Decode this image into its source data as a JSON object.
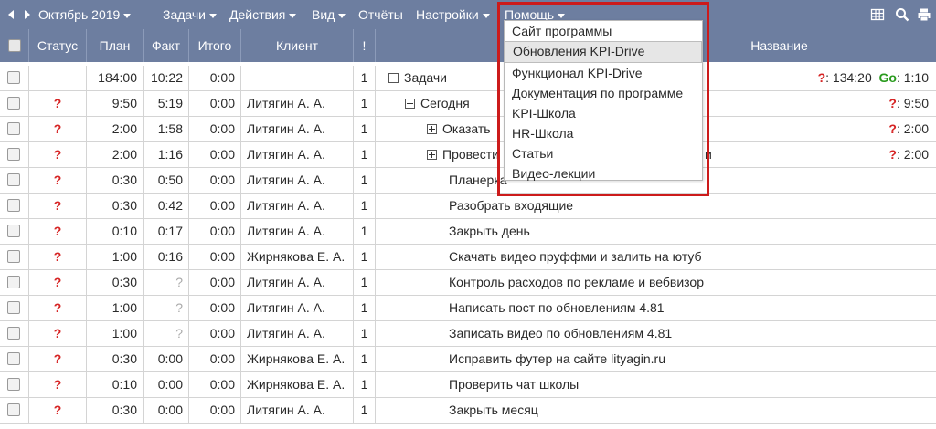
{
  "toolbar": {
    "period": "Октябрь 2019",
    "menus": [
      "Задачи",
      "Действия",
      "Вид",
      "Отчёты",
      "Настройки",
      "Помощь"
    ]
  },
  "columns": {
    "status": "Статус",
    "plan": "План",
    "fact": "Факт",
    "total": "Итого",
    "client": "Клиент",
    "excl": "!",
    "name": "Название"
  },
  "help_menu": {
    "items": [
      "Сайт программы",
      "Обновления KPI-Drive",
      "Функционал KPI-Drive",
      "Документация по программе",
      "KPI-Школа",
      "HR-Школа",
      "Статьи",
      "Видео-лекции"
    ],
    "hovered_index": 1
  },
  "rows": [
    {
      "status": "",
      "plan": "184:00",
      "fact": "10:22",
      "total": "0:00",
      "client": "",
      "excl": "1",
      "name": "Задачи",
      "tree": "minus",
      "indent": 0,
      "right_q": "?",
      "right_val": ": 134:20",
      "right_go": "Go",
      "right_go_val": ": 1:10"
    },
    {
      "status": "?",
      "plan": "9:50",
      "fact": "5:19",
      "total": "0:00",
      "client": "Литягин А. А.",
      "excl": "1",
      "name": "Сегодня",
      "tree": "minus",
      "indent": 1,
      "right_q": "?",
      "right_val": ": 9:50"
    },
    {
      "status": "?",
      "plan": "2:00",
      "fact": "1:58",
      "total": "0:00",
      "client": "Литягин А. А.",
      "excl": "1",
      "name": "Оказать",
      "tree": "plus",
      "indent": 2,
      "right_q": "?",
      "right_val": ": 2:00"
    },
    {
      "status": "?",
      "plan": "2:00",
      "fact": "1:16",
      "total": "0:00",
      "client": "Литягин А. А.",
      "excl": "1",
      "name": "Провести",
      "name_tail": "и",
      "tree": "plus",
      "indent": 2,
      "right_q": "?",
      "right_val": ": 2:00"
    },
    {
      "status": "?",
      "plan": "0:30",
      "fact": "0:50",
      "total": "0:00",
      "client": "Литягин А. А.",
      "excl": "1",
      "name": "Планерка",
      "indent": 3
    },
    {
      "status": "?",
      "plan": "0:30",
      "fact": "0:42",
      "total": "0:00",
      "client": "Литягин А. А.",
      "excl": "1",
      "name": "Разобрать входящие",
      "indent": 3
    },
    {
      "status": "?",
      "plan": "0:10",
      "fact": "0:17",
      "total": "0:00",
      "client": "Литягин А. А.",
      "excl": "1",
      "name": "Закрыть день",
      "indent": 3
    },
    {
      "status": "?",
      "plan": "1:00",
      "fact": "0:16",
      "total": "0:00",
      "client": "Жирнякова Е. А.",
      "excl": "1",
      "name": "Скачать видео пруффми и залить на ютуб",
      "indent": 3
    },
    {
      "status": "?",
      "plan": "0:30",
      "fact": "?",
      "total": "0:00",
      "client": "Литягин А. А.",
      "excl": "1",
      "name": "Контроль расходов по рекламе и вебвизор",
      "indent": 3
    },
    {
      "status": "?",
      "plan": "1:00",
      "fact": "?",
      "total": "0:00",
      "client": "Литягин А. А.",
      "excl": "1",
      "name": "Написать пост по обновлениям 4.81",
      "indent": 3
    },
    {
      "status": "?",
      "plan": "1:00",
      "fact": "?",
      "total": "0:00",
      "client": "Литягин А. А.",
      "excl": "1",
      "name": "Записать видео по обновлениям 4.81",
      "indent": 3
    },
    {
      "status": "?",
      "plan": "0:30",
      "fact": "0:00",
      "total": "0:00",
      "client": "Жирнякова Е. А.",
      "excl": "1",
      "name": "Исправить футер на сайте lityagin.ru",
      "indent": 3
    },
    {
      "status": "?",
      "plan": "0:10",
      "fact": "0:00",
      "total": "0:00",
      "client": "Жирнякова Е. А.",
      "excl": "1",
      "name": "Проверить чат школы",
      "indent": 3
    },
    {
      "status": "?",
      "plan": "0:30",
      "fact": "0:00",
      "total": "0:00",
      "client": "Литягин А. А.",
      "excl": "1",
      "name": "Закрыть месяц",
      "indent": 3
    }
  ],
  "icons": {
    "prev": "prev-arrow-icon",
    "next": "next-arrow-icon",
    "grid": "grid-icon",
    "search": "search-icon",
    "print": "print-icon"
  },
  "colors": {
    "header_bg": "#6d7ea0",
    "status_q": "#d62424",
    "go": "#2a9b1e",
    "highlight": "#cc1b1b"
  }
}
